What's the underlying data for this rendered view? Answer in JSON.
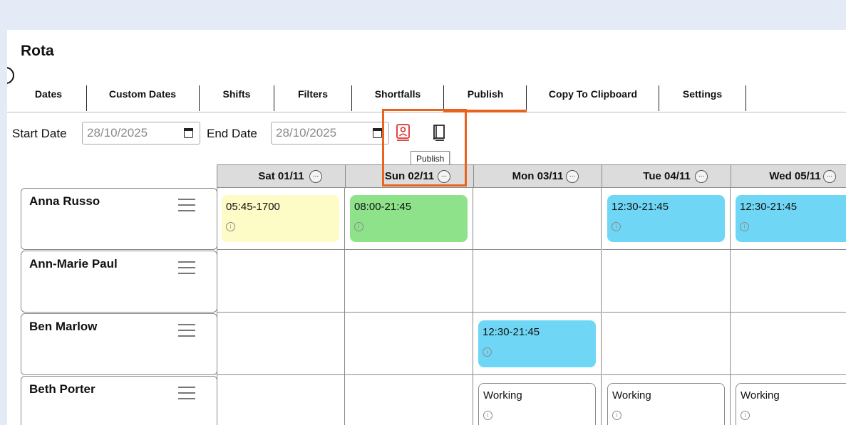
{
  "page": {
    "title": "Rota"
  },
  "tabs": [
    {
      "label": "Dates"
    },
    {
      "label": "Custom Dates"
    },
    {
      "label": "Shifts"
    },
    {
      "label": "Filters"
    },
    {
      "label": "Shortfalls"
    },
    {
      "label": "Publish"
    },
    {
      "label": "Copy To Clipboard"
    },
    {
      "label": "Settings"
    }
  ],
  "filters": {
    "start_label": "Start Date",
    "start_value": "28/10/2025",
    "end_label": "End Date",
    "end_value": "28/10/2025"
  },
  "tooltip": {
    "text": "Publish"
  },
  "days": [
    {
      "label": "Sat 01/11",
      "more": "..."
    },
    {
      "label": "Sun 02/11",
      "more": "..."
    },
    {
      "label": "Mon 03/11",
      "more": "..."
    },
    {
      "label": "Tue 04/11",
      "more": "..."
    },
    {
      "label": "Wed 05/11",
      "more": "..."
    }
  ],
  "staff": [
    {
      "name": "Anna Russo"
    },
    {
      "name": "Ann-Marie Paul"
    },
    {
      "name": "Ben Marlow"
    },
    {
      "name": "Beth Porter"
    }
  ],
  "shifts": [
    {
      "staff": 0,
      "day": 0,
      "text": "05:45-1700",
      "color": "#fdfcc6"
    },
    {
      "staff": 0,
      "day": 1,
      "text": "08:00-21:45",
      "color": "#8ee38a"
    },
    {
      "staff": 0,
      "day": 3,
      "text": "12:30-21:45",
      "color": "#6fd7f5"
    },
    {
      "staff": 0,
      "day": 4,
      "text": "12:30-21:45",
      "color": "#6fd7f5"
    },
    {
      "staff": 2,
      "day": 2,
      "text": "12:30-21:45",
      "color": "#6fd7f5"
    },
    {
      "staff": 3,
      "day": 2,
      "text": "Working",
      "color": "#ffffff"
    },
    {
      "staff": 3,
      "day": 3,
      "text": "Working",
      "color": "#ffffff"
    },
    {
      "staff": 3,
      "day": 4,
      "text": "Working",
      "color": "#ffffff"
    }
  ],
  "colors": {
    "accent": "#e8641e",
    "publish_icon": "#e03131"
  }
}
